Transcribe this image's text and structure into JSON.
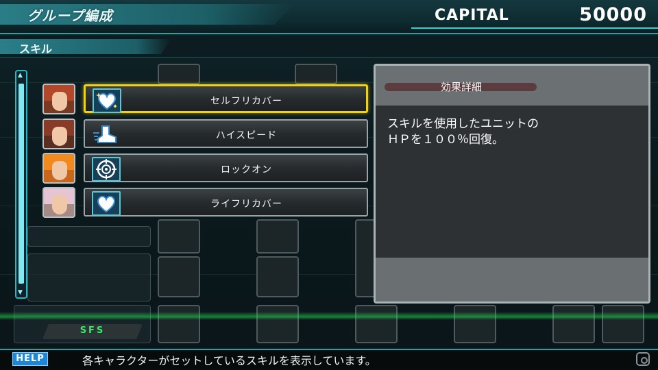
{
  "header": {
    "title": "グループ編成",
    "capital_label": "CAPITAL",
    "capital_value": "50000"
  },
  "section": {
    "label": "スキル"
  },
  "skills": [
    {
      "name": "セルフリカバー",
      "icon": "heart-sparkle-icon",
      "selected": true
    },
    {
      "name": "ハイスピード",
      "icon": "speed-boot-icon",
      "selected": false
    },
    {
      "name": "ロックオン",
      "icon": "crosshair-icon",
      "selected": false
    },
    {
      "name": "ライフリカバー",
      "icon": "heart-icon",
      "selected": false
    }
  ],
  "detail": {
    "title": "効果詳細",
    "text": "スキルを使用したユニットの\nＨＰを１００％回復。"
  },
  "bottom": {
    "sfs_label": "SFS"
  },
  "help": {
    "badge": "HELP",
    "text": "各キャラクターがセットしているスキルを表示しています。"
  },
  "colors": {
    "accent_teal": "#1ca7a8",
    "selected_border": "#f2d20a",
    "help_badge": "#1f88d6",
    "sfs_text": "#3de86e"
  }
}
